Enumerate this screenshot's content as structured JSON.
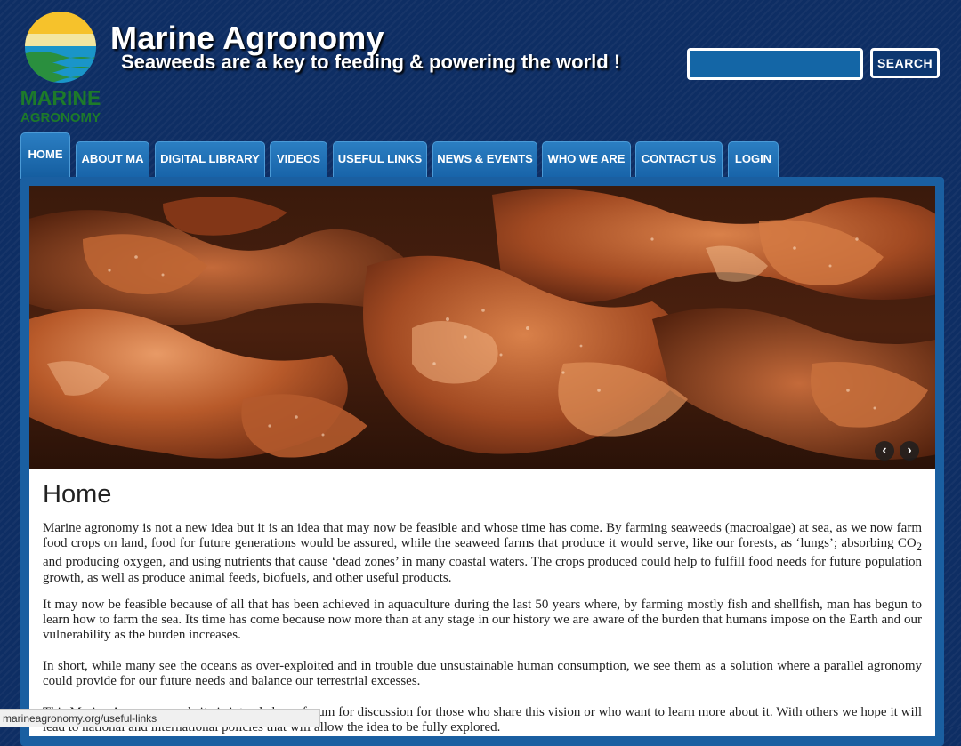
{
  "header": {
    "logo_text_line1": "MARINE",
    "logo_text_line2": "AGRONOMY",
    "title": "Marine Agronomy",
    "tagline": "Seaweeds are a key to feeding & powering the world !",
    "search_button": "SEARCH",
    "search_value": ""
  },
  "nav": {
    "items": [
      {
        "label": "HOME",
        "active": true
      },
      {
        "label": "ABOUT MA"
      },
      {
        "label": "DIGITAL LIBRARY"
      },
      {
        "label": "VIDEOS"
      },
      {
        "label": "USEFUL LINKS"
      },
      {
        "label": "NEWS & EVENTS"
      },
      {
        "label": "WHO WE ARE"
      },
      {
        "label": "CONTACT US"
      },
      {
        "label": "LOGIN"
      }
    ]
  },
  "slider": {
    "prev_label": "‹",
    "next_label": "›"
  },
  "main": {
    "heading": "Home",
    "paragraphs": [
      {
        "before_sub": "Marine agronomy is not a new idea but it is an idea that may now be feasible and whose time has come. By farming seaweeds (macroalgae) at sea, as we now farm food crops on land, food for future generations would be assured, while the seaweed farms that produce it would serve, like our forests, as ‘lungs’; absorbing CO",
        "sub": "2",
        "after_sub": " and producing oxygen, and using nutrients that cause ‘dead zones’ in many coastal waters. The crops produced could help to fulfill food needs for future population growth, as well as produce animal feeds, biofuels, and other useful products."
      },
      {
        "text": "It may now be feasible because of all that has been achieved in aquaculture during the last 50 years where, by farming mostly fish and shellfish, man has begun to learn how to farm the sea. Its time has come because now more than at any stage in our history we are aware of the burden that humans impose on the Earth and our vulnerability as the burden increases."
      },
      {
        "text": "In short, while many see the oceans as over-exploited and in trouble due unsustainable human consumption, we see them as a solution where a parallel agronomy could provide for our future needs and balance our terrestrial excesses."
      },
      {
        "text": "This Marine Agronomy website is intended as a forum for discussion for those who share this vision or who want to learn more about it. With others we hope it will lead to national and international policies that will allow the idea to be fully explored."
      }
    ]
  },
  "status_bar": {
    "url": "marineagronomy.org/useful-links"
  },
  "colors": {
    "background": "#0e2e64",
    "tab": "#1f70b5",
    "panel": "#1a5fa1",
    "logo_green": "#1d7a2a"
  }
}
